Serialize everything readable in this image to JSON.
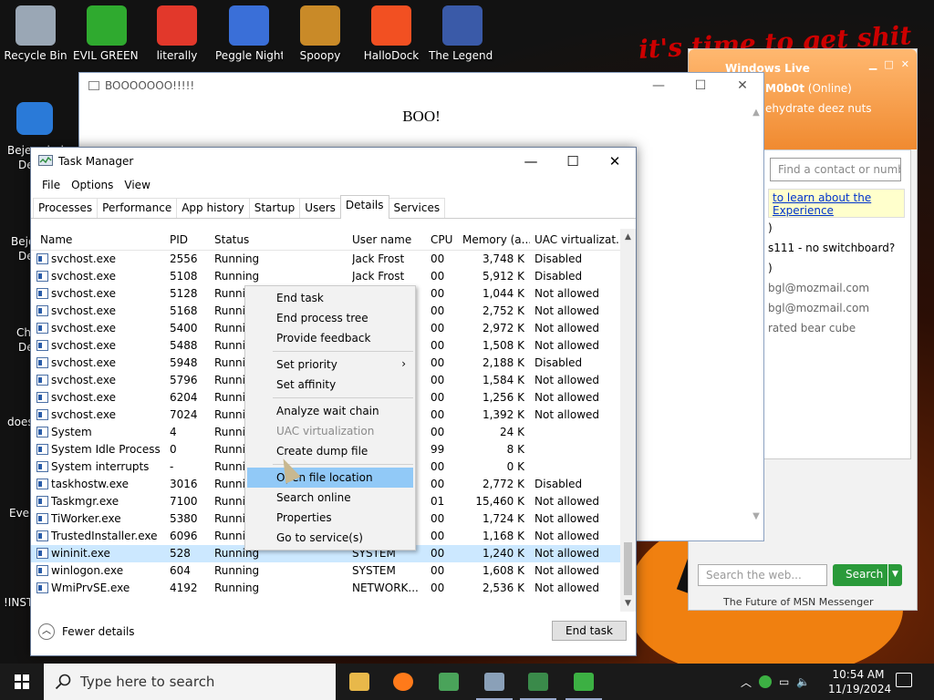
{
  "desktop": {
    "icons": [
      {
        "label": "Recycle Bin",
        "color": "#9aa7b5"
      },
      {
        "label": "EVIL GREEN MSN GO...",
        "color": "#2faa2f"
      },
      {
        "label": "literally",
        "color": "#e2382b"
      },
      {
        "label": "Peggle Nights Del...",
        "color": "#3a6fd8"
      },
      {
        "label": "Spoopy",
        "color": "#c98a28"
      },
      {
        "label": "HalloDock",
        "color": "#f25022"
      },
      {
        "label": "The Legend of Tik...",
        "color": "#3a5aa8"
      }
    ],
    "left_labels": [
      "Bejeweled",
      "De",
      "Beje",
      "De",
      "Ch",
      "De",
      "does",
      "Ever",
      "!INST"
    ],
    "banner": "it's time to get shit"
  },
  "boo_window": {
    "title": "BOOOOOOO!!!!!",
    "text": "BOO!"
  },
  "msn": {
    "brand": "Windows Live",
    "username": "M0b0t",
    "status": "(Online)",
    "mood": "ehydrate deez nuts",
    "contact_search_placeholder": "Find a contact or number",
    "info_link": "to learn about the Experience",
    "contacts": [
      ")",
      "s111 - no switchboard?",
      ")",
      "bgl@mozmail.com",
      "bgl@mozmail.com",
      "rated bear cube"
    ],
    "web_search_placeholder": "Search the web...",
    "search_button": "Search",
    "footer": "The Future of MSN Messenger"
  },
  "taskmanager": {
    "title": "Task Manager",
    "menu": [
      "File",
      "Options",
      "View"
    ],
    "tabs": [
      "Processes",
      "Performance",
      "App history",
      "Startup",
      "Users",
      "Details",
      "Services"
    ],
    "active_tab": "Details",
    "columns": [
      "Name",
      "PID",
      "Status",
      "User name",
      "CPU",
      "Memory (a...",
      "UAC virtualizat..."
    ],
    "rows": [
      {
        "name": "svchost.exe",
        "pid": "2556",
        "status": "Running",
        "user": "Jack Frost",
        "cpu": "00",
        "mem": "3,748 K",
        "uac": "Disabled"
      },
      {
        "name": "svchost.exe",
        "pid": "5108",
        "status": "Running",
        "user": "Jack Frost",
        "cpu": "00",
        "mem": "5,912 K",
        "uac": "Disabled"
      },
      {
        "name": "svchost.exe",
        "pid": "5128",
        "status": "Runnir",
        "user": "",
        "cpu": "00",
        "mem": "1,044 K",
        "uac": "Not allowed"
      },
      {
        "name": "svchost.exe",
        "pid": "5168",
        "status": "Runnir",
        "user": "",
        "cpu": "00",
        "mem": "2,752 K",
        "uac": "Not allowed"
      },
      {
        "name": "svchost.exe",
        "pid": "5400",
        "status": "Runnir",
        "user": "",
        "cpu": "00",
        "mem": "2,972 K",
        "uac": "Not allowed"
      },
      {
        "name": "svchost.exe",
        "pid": "5488",
        "status": "Runnir",
        "user": "",
        "cpu": "00",
        "mem": "1,508 K",
        "uac": "Not allowed"
      },
      {
        "name": "svchost.exe",
        "pid": "5948",
        "status": "Runnir",
        "user": "",
        "cpu": "00",
        "mem": "2,188 K",
        "uac": "Disabled"
      },
      {
        "name": "svchost.exe",
        "pid": "5796",
        "status": "Runnir",
        "user": "",
        "cpu": "00",
        "mem": "1,584 K",
        "uac": "Not allowed"
      },
      {
        "name": "svchost.exe",
        "pid": "6204",
        "status": "Runnir",
        "user": "",
        "cpu": "00",
        "mem": "1,256 K",
        "uac": "Not allowed"
      },
      {
        "name": "svchost.exe",
        "pid": "7024",
        "status": "Runnir",
        "user": "",
        "cpu": "00",
        "mem": "1,392 K",
        "uac": "Not allowed"
      },
      {
        "name": "System",
        "pid": "4",
        "status": "Runnir",
        "user": "",
        "cpu": "00",
        "mem": "24 K",
        "uac": ""
      },
      {
        "name": "System Idle Process",
        "pid": "0",
        "status": "Runnir",
        "user": "",
        "cpu": "99",
        "mem": "8 K",
        "uac": ""
      },
      {
        "name": "System interrupts",
        "pid": "-",
        "status": "Runnir",
        "user": "",
        "cpu": "00",
        "mem": "0 K",
        "uac": ""
      },
      {
        "name": "taskhostw.exe",
        "pid": "3016",
        "status": "Runnir",
        "user": "",
        "cpu": "00",
        "mem": "2,772 K",
        "uac": "Disabled"
      },
      {
        "name": "Taskmgr.exe",
        "pid": "7100",
        "status": "Runnir",
        "user": "",
        "cpu": "01",
        "mem": "15,460 K",
        "uac": "Not allowed"
      },
      {
        "name": "TiWorker.exe",
        "pid": "5380",
        "status": "Runnir",
        "user": "",
        "cpu": "00",
        "mem": "1,724 K",
        "uac": "Not allowed"
      },
      {
        "name": "TrustedInstaller.exe",
        "pid": "6096",
        "status": "Runnir",
        "user": "",
        "cpu": "00",
        "mem": "1,168 K",
        "uac": "Not allowed"
      },
      {
        "name": "wininit.exe",
        "pid": "528",
        "status": "Running",
        "user": "SYSTEM",
        "cpu": "00",
        "mem": "1,240 K",
        "uac": "Not allowed"
      },
      {
        "name": "winlogon.exe",
        "pid": "604",
        "status": "Running",
        "user": "SYSTEM",
        "cpu": "00",
        "mem": "1,608 K",
        "uac": "Not allowed"
      },
      {
        "name": "WmiPrvSE.exe",
        "pid": "4192",
        "status": "Running",
        "user": "NETWORK...",
        "cpu": "00",
        "mem": "2,536 K",
        "uac": "Not allowed"
      }
    ],
    "selected_row": "wininit.exe",
    "fewer_details": "Fewer details",
    "end_task": "End task"
  },
  "context_menu": {
    "items": [
      {
        "label": "End task",
        "kind": "normal"
      },
      {
        "label": "End process tree",
        "kind": "normal"
      },
      {
        "label": "Provide feedback",
        "kind": "normal"
      },
      {
        "kind": "separator"
      },
      {
        "label": "Set priority",
        "kind": "submenu"
      },
      {
        "label": "Set affinity",
        "kind": "normal"
      },
      {
        "kind": "separator"
      },
      {
        "label": "Analyze wait chain",
        "kind": "normal"
      },
      {
        "label": "UAC virtualization",
        "kind": "disabled"
      },
      {
        "label": "Create dump file",
        "kind": "normal"
      },
      {
        "kind": "separator"
      },
      {
        "label": "Open file location",
        "kind": "highlighted"
      },
      {
        "label": "Search online",
        "kind": "normal"
      },
      {
        "label": "Properties",
        "kind": "normal"
      },
      {
        "label": "Go to service(s)",
        "kind": "normal"
      }
    ],
    "submenu_arrow": "›"
  },
  "taskbar": {
    "search_placeholder": "Type here to search",
    "apps": [
      {
        "name": "file-explorer",
        "color": "#e8b84a"
      },
      {
        "name": "firefox",
        "color": "#ff7a1a"
      },
      {
        "name": "google-maps",
        "color": "#4aa35a"
      },
      {
        "name": "task-manager",
        "color": "#8aa0b8"
      },
      {
        "name": "boo-app",
        "color": "#3a8a4a"
      },
      {
        "name": "msn-messenger",
        "color": "#3cb043"
      }
    ],
    "time": "10:54 AM",
    "date": "11/19/2024"
  }
}
